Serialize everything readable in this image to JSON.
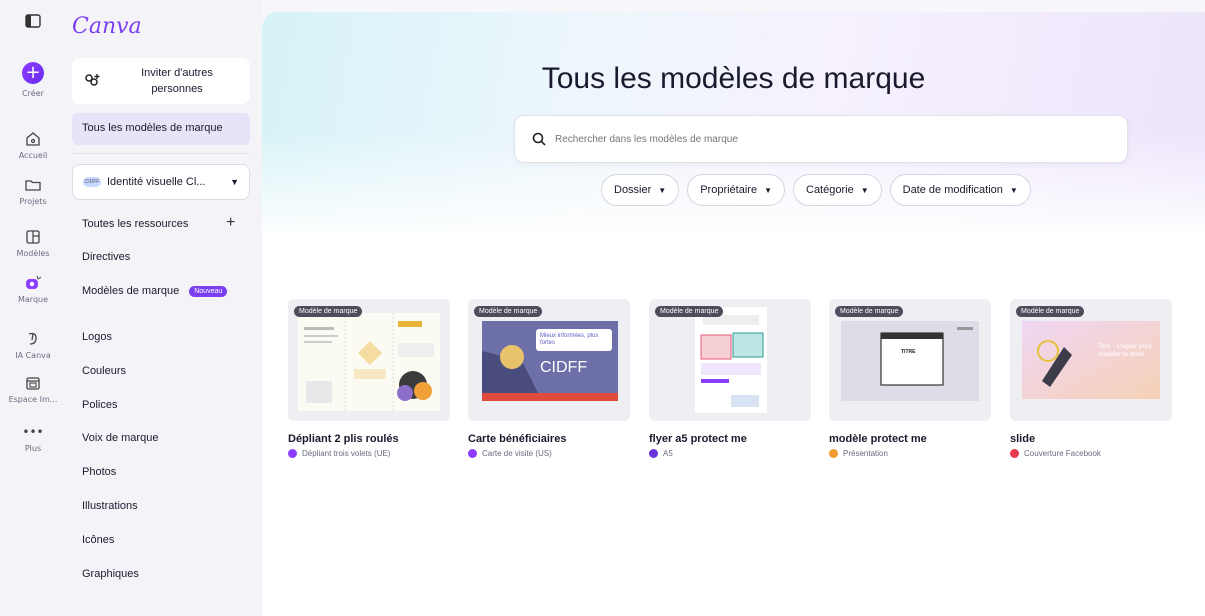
{
  "rail": {
    "items": [
      {
        "label": "Créer",
        "icon": "plus-icon"
      },
      {
        "label": "Accueil",
        "icon": "home-icon"
      },
      {
        "label": "Projets",
        "icon": "folder-icon"
      },
      {
        "label": "Modèles",
        "icon": "template-icon"
      },
      {
        "label": "Marque",
        "icon": "brand-icon"
      },
      {
        "label": "IA Canva",
        "icon": "ai-icon"
      },
      {
        "label": "Espace Im...",
        "icon": "print-icon"
      },
      {
        "label": "Plus",
        "icon": "more-icon"
      }
    ]
  },
  "sidebar": {
    "logo": "Canva",
    "invite": "Inviter d'autres personnes",
    "all_models": "Tous les modèles de marque",
    "brand_kit": "Identité visuelle Cl...",
    "brand_kit_dot": "CIDFF",
    "resources": "Toutes les ressources",
    "items": [
      {
        "label": "Directives"
      },
      {
        "label": "Modèles de marque",
        "badge": "Nouveau"
      },
      {
        "label": "Logos"
      },
      {
        "label": "Couleurs"
      },
      {
        "label": "Polices"
      },
      {
        "label": "Voix de marque"
      },
      {
        "label": "Photos"
      },
      {
        "label": "Illustrations"
      },
      {
        "label": "Icônes"
      },
      {
        "label": "Graphiques"
      }
    ]
  },
  "main": {
    "title": "Tous les modèles de marque",
    "search_placeholder": "Rechercher dans les modèles de marque",
    "filters": [
      "Dossier",
      "Propriétaire",
      "Catégorie",
      "Date de modification"
    ],
    "tag": "Modèle de marque",
    "cards": [
      {
        "title": "Dépliant 2 plis roulés",
        "subtitle": "Dépliant trois volets (UE)",
        "color": "#8b3dff"
      },
      {
        "title": "Carte bénéficiaires",
        "subtitle": "Carte de visite (US)",
        "color": "#8b3dff"
      },
      {
        "title": "flyer a5 protect me",
        "subtitle": "A5",
        "color": "#6a35d8"
      },
      {
        "title": "modèle protect me",
        "subtitle": "Présentation",
        "color": "#f29a2e"
      },
      {
        "title": "slide",
        "subtitle": "Couverture Facebook",
        "color": "#e83a4f"
      }
    ],
    "thumb_texts": {
      "card2_heading": "Mieux informées, plus fortes",
      "card2_brand": "CIDFF",
      "card4_title": "TITRE",
      "card5_text": "Titre - Cliquer pour modifier le texte"
    }
  },
  "colors": {
    "accent": "#7b3ff2",
    "badge": "#7b3ff2",
    "tag_bg": "#4d4d5c"
  }
}
